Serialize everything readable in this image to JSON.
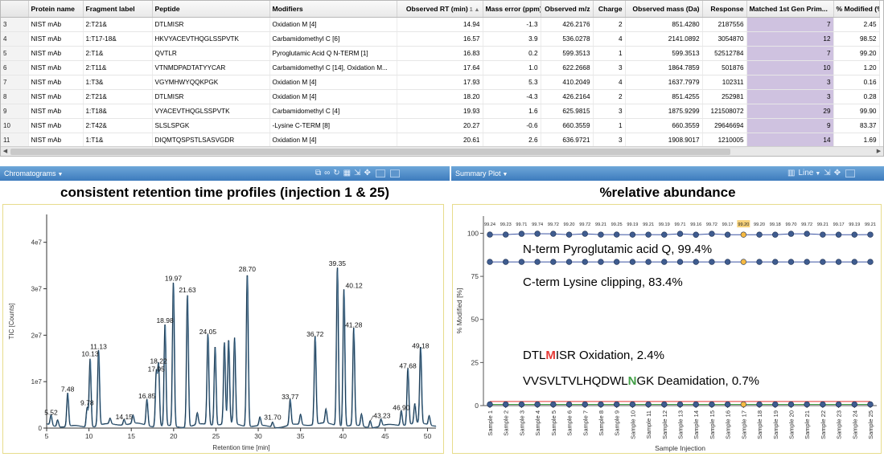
{
  "table": {
    "columns": [
      "Protein name",
      "Fragment label",
      "Peptide",
      "Modifiers",
      "Observed RT (min)",
      "Mass error (ppm)",
      "Observed m/z",
      "Charge",
      "Observed mass (Da)",
      "Response",
      "Matched 1st Gen Prim...",
      "% Modified (%)"
    ],
    "sort_indicator": "1 ▲",
    "rows": [
      {
        "rn": "3",
        "protein": "NIST mAb",
        "fragment": "2:T21&",
        "peptide": "DTLMISR",
        "modifiers": "Oxidation M [4]",
        "rt": "14.94",
        "mass_error": "-1.3",
        "mz": "426.2176",
        "charge": "2",
        "mass": "851.4280",
        "response": "2187556",
        "matched": "7",
        "modified": "2.45"
      },
      {
        "rn": "4",
        "protein": "NIST mAb",
        "fragment": "1:T17-18&",
        "peptide": "HKVYACEVTHQGLSSPVTK",
        "modifiers": "Carbamidomethyl C [6]",
        "rt": "16.57",
        "mass_error": "3.9",
        "mz": "536.0278",
        "charge": "4",
        "mass": "2141.0892",
        "response": "3054870",
        "matched": "12",
        "modified": "98.52"
      },
      {
        "rn": "5",
        "protein": "NIST mAb",
        "fragment": "2:T1&",
        "peptide": "QVTLR",
        "modifiers": "Pyroglutamic Acid Q N-TERM [1]",
        "rt": "16.83",
        "mass_error": "0.2",
        "mz": "599.3513",
        "charge": "1",
        "mass": "599.3513",
        "response": "52512784",
        "matched": "7",
        "modified": "99.20"
      },
      {
        "rn": "6",
        "protein": "NIST mAb",
        "fragment": "2:T11&",
        "peptide": "VTNMDPADTATYYCAR",
        "modifiers": "Carbamidomethyl C [14], Oxidation M...",
        "rt": "17.64",
        "mass_error": "1.0",
        "mz": "622.2668",
        "charge": "3",
        "mass": "1864.7859",
        "response": "501876",
        "matched": "10",
        "modified": "1.20"
      },
      {
        "rn": "7",
        "protein": "NIST mAb",
        "fragment": "1:T3&",
        "peptide": "VGYMHWYQQKPGK",
        "modifiers": "Oxidation M [4]",
        "rt": "17.93",
        "mass_error": "5.3",
        "mz": "410.2049",
        "charge": "4",
        "mass": "1637.7979",
        "response": "102311",
        "matched": "3",
        "modified": "0.16"
      },
      {
        "rn": "8",
        "protein": "NIST mAb",
        "fragment": "2:T21&",
        "peptide": "DTLMISR",
        "modifiers": "Oxidation M [4]",
        "rt": "18.20",
        "mass_error": "-4.3",
        "mz": "426.2164",
        "charge": "2",
        "mass": "851.4255",
        "response": "252981",
        "matched": "3",
        "modified": "0.28"
      },
      {
        "rn": "9",
        "protein": "NIST mAb",
        "fragment": "1:T18&",
        "peptide": "VYACEVTHQGLSSPVTK",
        "modifiers": "Carbamidomethyl C [4]",
        "rt": "19.93",
        "mass_error": "1.6",
        "mz": "625.9815",
        "charge": "3",
        "mass": "1875.9299",
        "response": "121508072",
        "matched": "29",
        "modified": "99.90"
      },
      {
        "rn": "10",
        "protein": "NIST mAb",
        "fragment": "2:T42&",
        "peptide": "SLSLSPGK",
        "modifiers": "-Lysine C-TERM [8]",
        "rt": "20.27",
        "mass_error": "-0.6",
        "mz": "660.3559",
        "charge": "1",
        "mass": "660.3559",
        "response": "29646694",
        "matched": "9",
        "modified": "83.37"
      },
      {
        "rn": "11",
        "protein": "NIST mAb",
        "fragment": "1:T1&",
        "peptide": "DIQMTQSPSTLSASVGDR",
        "modifiers": "Oxidation M [4]",
        "rt": "20.61",
        "mass_error": "2.6",
        "mz": "636.9721",
        "charge": "3",
        "mass": "1908.9017",
        "response": "1210005",
        "matched": "14",
        "modified": "1.69"
      }
    ]
  },
  "panes": {
    "left_tab": "Chromatograms",
    "right_tab": "Summary Plot",
    "right_view": "Line"
  },
  "icons": {
    "left_toolbar": [
      "copy-icon",
      "link-icon",
      "refresh-icon",
      "table-icon",
      "export-icon",
      "move-icon",
      "minimize-icon",
      "maximize-icon"
    ],
    "right_toolbar": [
      "bar-chart-icon",
      "dropdown-icon",
      "export-icon",
      "move-icon",
      "minimize-icon"
    ]
  },
  "colors": {
    "header_blue": "#4a87c6",
    "matched_fill": "#cfc2e0",
    "trace": "#1c3a52",
    "series_line": "#3b54a3",
    "marker": "#3f5c8f",
    "highlight": "#f5b942",
    "green_line": "#43a047",
    "red_line": "#e53935"
  },
  "chart_data": [
    {
      "type": "line",
      "title": "consistent retention time profiles (injection 1 & 25)",
      "xlabel": "Retention time [min]",
      "ylabel": "TIC [Counts]",
      "xlim": [
        5,
        51
      ],
      "ylim": [
        0,
        46000000.0
      ],
      "x_ticks": [
        "5",
        "10",
        "15",
        "20",
        "25",
        "30",
        "35",
        "40",
        "45",
        "50"
      ],
      "y_ticks": [
        "0",
        "1e7",
        "2e7",
        "3e7",
        "4e7"
      ],
      "peaks": [
        {
          "x": 5.52,
          "y": 2200000,
          "label": "5.52"
        },
        {
          "x": 7.48,
          "y": 7200000,
          "label": "7.48"
        },
        {
          "x": 9.78,
          "y": 4200000,
          "label": "9.78"
        },
        {
          "x": 10.13,
          "y": 14800000,
          "label": "10.13"
        },
        {
          "x": 11.13,
          "y": 16300000,
          "label": "11.13"
        },
        {
          "x": 14.15,
          "y": 1200000,
          "label": "14.15"
        },
        {
          "x": 16.85,
          "y": 5700000,
          "label": "16.85"
        },
        {
          "x": 17.95,
          "y": 11500000,
          "label": "17.95"
        },
        {
          "x": 18.22,
          "y": 13200000,
          "label": "18.22"
        },
        {
          "x": 18.98,
          "y": 22000000,
          "label": "18.98"
        },
        {
          "x": 19.97,
          "y": 31000000,
          "label": "19.97"
        },
        {
          "x": 21.63,
          "y": 28500000,
          "label": "21.63"
        },
        {
          "x": 24.05,
          "y": 19500000,
          "label": "24.05"
        },
        {
          "x": 28.7,
          "y": 33000000,
          "label": "28.70"
        },
        {
          "x": 31.7,
          "y": 1100000,
          "label": "31.70"
        },
        {
          "x": 33.77,
          "y": 5500000,
          "label": "33.77"
        },
        {
          "x": 36.72,
          "y": 19000000,
          "label": "36.72"
        },
        {
          "x": 39.35,
          "y": 34200000,
          "label": "39.35"
        },
        {
          "x": 40.12,
          "y": 29500000,
          "label": "40.12"
        },
        {
          "x": 41.28,
          "y": 21000000,
          "label": "41.28"
        },
        {
          "x": 43.23,
          "y": 1500000,
          "label": "43.23"
        },
        {
          "x": 46.9,
          "y": 3200000,
          "label": "46.90"
        },
        {
          "x": 47.68,
          "y": 12200000,
          "label": "47.68"
        },
        {
          "x": 49.18,
          "y": 16500000,
          "label": "49.18"
        }
      ],
      "extra_peaks": [
        {
          "x": 6.3,
          "y": 1500000
        },
        {
          "x": 12.5,
          "y": 1200000
        },
        {
          "x": 15.2,
          "y": 1800000
        },
        {
          "x": 22.8,
          "y": 2500000
        },
        {
          "x": 24.9,
          "y": 17000000
        },
        {
          "x": 26.0,
          "y": 17500000
        },
        {
          "x": 26.5,
          "y": 18000000
        },
        {
          "x": 27.2,
          "y": 18500000
        },
        {
          "x": 30.2,
          "y": 1800000
        },
        {
          "x": 35.0,
          "y": 2200000
        },
        {
          "x": 38.0,
          "y": 3000000
        },
        {
          "x": 42.2,
          "y": 2600000
        },
        {
          "x": 44.5,
          "y": 1500000
        },
        {
          "x": 48.5,
          "y": 4200000
        },
        {
          "x": 50.2,
          "y": 2000000
        }
      ]
    },
    {
      "type": "line",
      "title": "%relative abundance",
      "xlabel": "Sample Injection",
      "ylabel": "% Modified [%]",
      "ylim": [
        0,
        110
      ],
      "y_ticks": [
        "0",
        "25",
        "50",
        "75",
        "100"
      ],
      "categories": [
        "Sample 1",
        "Sample 2",
        "Sample 3",
        "Sample 4",
        "Sample 5",
        "Sample 6",
        "Sample 7",
        "Sample 8",
        "Sample 9",
        "Sample 10",
        "Sample 11",
        "Sample 12",
        "Sample 13",
        "Sample 14",
        "Sample 15",
        "Sample 16",
        "Sample 17",
        "Sample 18",
        "Sample 19",
        "Sample 20",
        "Sample 21",
        "Sample 22",
        "Sample 23",
        "Sample 24",
        "Sample 25"
      ],
      "highlight_index": 16,
      "series": [
        {
          "values": [
            99.24,
            99.23,
            99.71,
            99.74,
            99.72,
            99.2,
            99.72,
            99.21,
            99.25,
            99.19,
            99.21,
            99.19,
            99.71,
            99.16,
            99.72,
            99.17,
            99.2,
            99.2,
            99.18,
            99.7,
            99.72,
            99.21,
            99.17,
            99.19,
            99.21
          ],
          "labels": [
            "99.24",
            "99.23",
            "99.71",
            "99.74",
            "99.72",
            "99.20",
            "99.72",
            "99.21",
            "99.25",
            "99.19",
            "99.21",
            "99.19",
            "99.71",
            "99.16",
            "99.72",
            "99.17",
            "99.20",
            "99.20",
            "99.18",
            "99.70",
            "99.72",
            "99.21",
            "99.17",
            "99.19",
            "99.21"
          ]
        },
        {
          "values": [
            83.4,
            83.4,
            83.4,
            83.4,
            83.4,
            83.4,
            83.4,
            83.4,
            83.4,
            83.4,
            83.4,
            83.4,
            83.4,
            83.4,
            83.4,
            83.4,
            83.4,
            83.4,
            83.4,
            83.4,
            83.4,
            83.4,
            83.4,
            83.4,
            83.4
          ]
        },
        {
          "values": [
            2.4,
            2.4,
            2.4,
            2.4,
            2.4,
            2.4,
            2.4,
            2.4,
            2.4,
            2.4,
            2.4,
            2.4,
            2.4,
            2.4,
            2.4,
            2.4,
            2.4,
            2.4,
            2.4,
            2.4,
            2.4,
            2.4,
            2.4,
            2.4,
            2.4
          ]
        },
        {
          "values": [
            0.7,
            0.7,
            0.7,
            0.7,
            0.7,
            0.7,
            0.7,
            0.7,
            0.7,
            0.7,
            0.7,
            0.7,
            0.7,
            0.7,
            0.7,
            0.7,
            0.7,
            0.7,
            0.7,
            0.7,
            0.7,
            0.7,
            0.7,
            0.7,
            0.7
          ]
        }
      ],
      "annotations": [
        {
          "parts": [
            {
              "t": "N-term Pyroglutamic acid Q, 99.4%",
              "c": "#000000"
            }
          ]
        },
        {
          "parts": [
            {
              "t": "C-term Lysine clipping, 83.4%",
              "c": "#000000"
            }
          ]
        },
        {
          "parts": [
            {
              "t": "DTL",
              "c": "#000000"
            },
            {
              "t": "M",
              "c": "#e53935"
            },
            {
              "t": "ISR Oxidation, 2.4%",
              "c": "#000000"
            }
          ]
        },
        {
          "parts": [
            {
              "t": "VVSVLTVLHQDWL",
              "c": "#000000"
            },
            {
              "t": "N",
              "c": "#43a047"
            },
            {
              "t": "GK Deamidation, 0.7%",
              "c": "#000000"
            }
          ]
        }
      ]
    }
  ]
}
